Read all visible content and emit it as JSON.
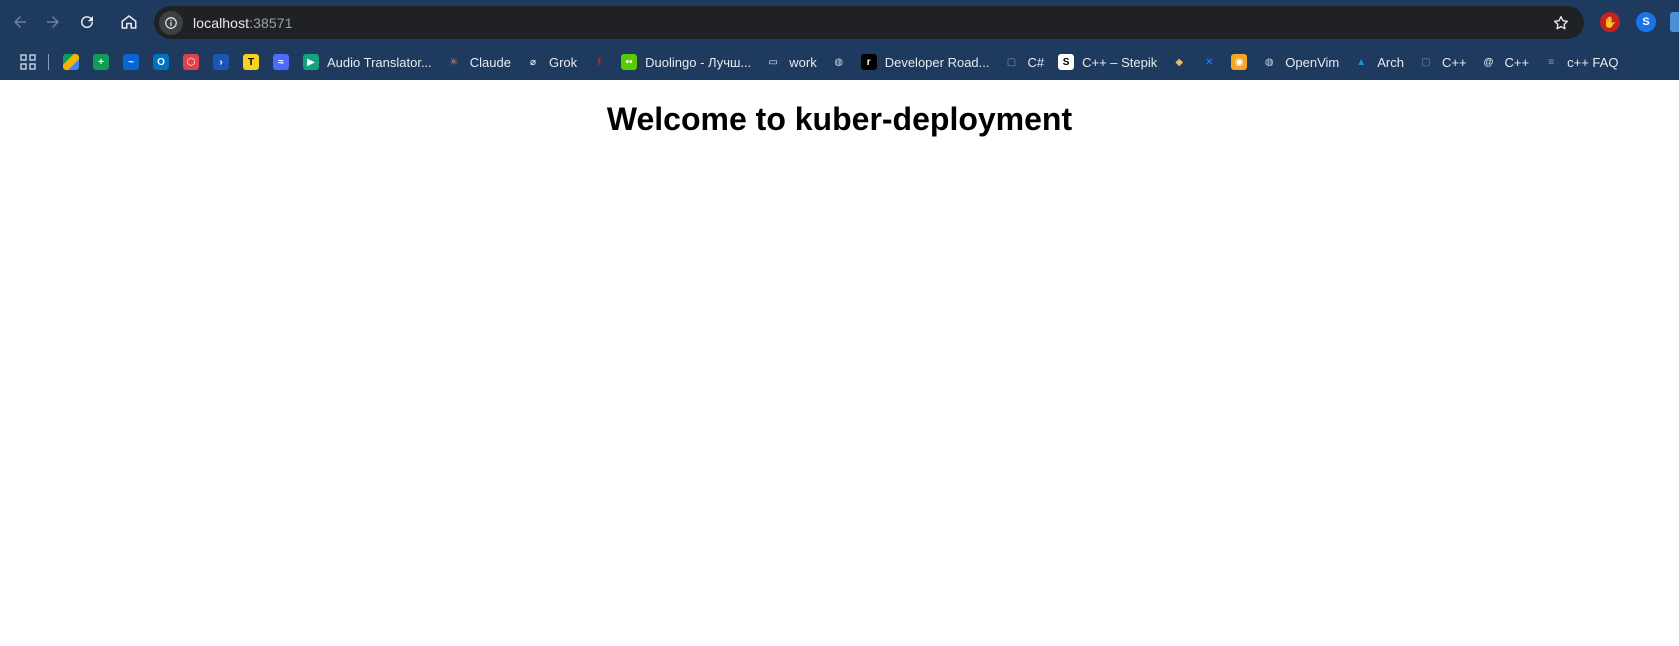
{
  "browser": {
    "url_host": "localhost",
    "url_port": ":38571",
    "colors": {
      "frame": "#1f3a5f",
      "omnibox": "#202124"
    },
    "nav_icons": [
      "back-icon",
      "forward-icon",
      "reload-icon",
      "home-icon"
    ]
  },
  "bookmarks": {
    "items": [
      {
        "label": "",
        "icon": "google-drive-icon"
      },
      {
        "label": "",
        "icon": "google-sheets-icon"
      },
      {
        "label": "",
        "icon": "onedrive-icon"
      },
      {
        "label": "",
        "icon": "outlook-icon"
      },
      {
        "label": "",
        "icon": "hex-icon"
      },
      {
        "label": "",
        "icon": "powershell-icon"
      },
      {
        "label": "",
        "icon": "t-icon"
      },
      {
        "label": "",
        "icon": "deepseek-icon"
      },
      {
        "label": "Audio Translator...",
        "icon": "play-icon"
      },
      {
        "label": "Claude",
        "icon": "claude-icon"
      },
      {
        "label": "Grok",
        "icon": "grok-icon"
      },
      {
        "label": "",
        "icon": "red-f-icon"
      },
      {
        "label": "Duolingo - Лучш...",
        "icon": "duolingo-icon"
      },
      {
        "label": "work",
        "icon": "folder-icon"
      },
      {
        "label": "",
        "icon": "globe-icon"
      },
      {
        "label": "Developer Road...",
        "icon": "roadmap-icon"
      },
      {
        "label": "C#",
        "icon": "book-icon"
      },
      {
        "label": "C++ – Stepik",
        "icon": "stepik-icon"
      },
      {
        "label": "",
        "icon": "owl-icon"
      },
      {
        "label": "",
        "icon": "confluence-icon"
      },
      {
        "label": "",
        "icon": "lion-icon"
      },
      {
        "label": "OpenVim",
        "icon": "globe-icon"
      },
      {
        "label": "Arch",
        "icon": "arch-icon"
      },
      {
        "label": "C++",
        "icon": "book-icon"
      },
      {
        "label": "C++",
        "icon": "cplusplus-icon"
      },
      {
        "label": "c++ FAQ",
        "icon": "stackoverflow-icon"
      }
    ]
  },
  "page": {
    "heading": "Welcome to kuber-deployment"
  }
}
